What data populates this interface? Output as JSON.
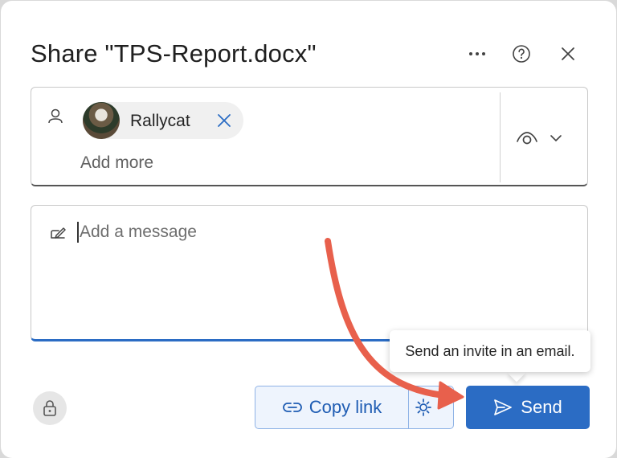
{
  "dialog": {
    "title": "Share \"TPS-Report.docx\"",
    "more_icon": "more-horizontal-icon",
    "help_icon": "question-circle-icon",
    "close_icon": "close-icon"
  },
  "recipients": {
    "people_icon": "person-icon",
    "chips": [
      {
        "name": "Rallycat",
        "remove_icon": "dismiss-icon"
      }
    ],
    "add_more_placeholder": "Add more",
    "permission_icon": "eye-icon",
    "permission_dropdown_icon": "chevron-down-icon"
  },
  "message": {
    "icon": "compose-icon",
    "placeholder": "Add a message"
  },
  "footer": {
    "lock_icon": "lock-icon",
    "copy_link_label": "Copy link",
    "link_settings_icon": "gear-icon",
    "send_label": "Send",
    "send_icon": "send-icon"
  },
  "tooltip": {
    "text": "Send an invite in an email."
  },
  "colors": {
    "accent": "#2b6cc4",
    "annotation_arrow": "#e8604c"
  }
}
